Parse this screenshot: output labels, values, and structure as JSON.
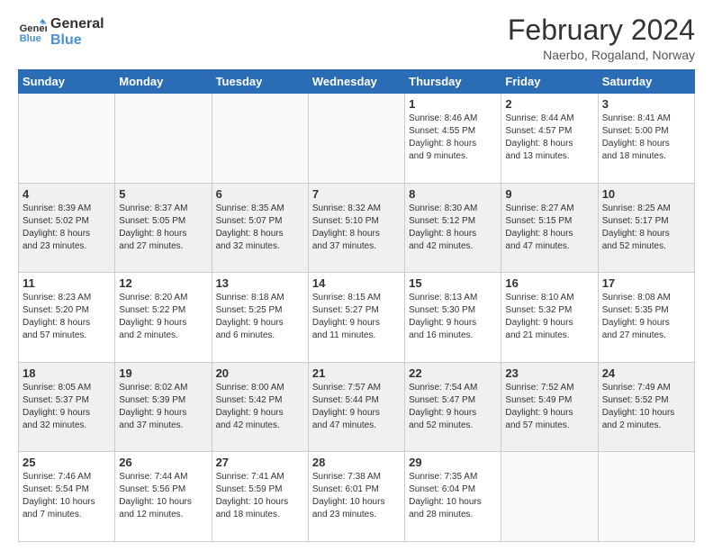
{
  "logo": {
    "text_general": "General",
    "text_blue": "Blue"
  },
  "title": "February 2024",
  "subtitle": "Naerbo, Rogaland, Norway",
  "days_of_week": [
    "Sunday",
    "Monday",
    "Tuesday",
    "Wednesday",
    "Thursday",
    "Friday",
    "Saturday"
  ],
  "weeks": [
    [
      {
        "day": "",
        "info": ""
      },
      {
        "day": "",
        "info": ""
      },
      {
        "day": "",
        "info": ""
      },
      {
        "day": "",
        "info": ""
      },
      {
        "day": "1",
        "info": "Sunrise: 8:46 AM\nSunset: 4:55 PM\nDaylight: 8 hours\nand 9 minutes."
      },
      {
        "day": "2",
        "info": "Sunrise: 8:44 AM\nSunset: 4:57 PM\nDaylight: 8 hours\nand 13 minutes."
      },
      {
        "day": "3",
        "info": "Sunrise: 8:41 AM\nSunset: 5:00 PM\nDaylight: 8 hours\nand 18 minutes."
      }
    ],
    [
      {
        "day": "4",
        "info": "Sunrise: 8:39 AM\nSunset: 5:02 PM\nDaylight: 8 hours\nand 23 minutes."
      },
      {
        "day": "5",
        "info": "Sunrise: 8:37 AM\nSunset: 5:05 PM\nDaylight: 8 hours\nand 27 minutes."
      },
      {
        "day": "6",
        "info": "Sunrise: 8:35 AM\nSunset: 5:07 PM\nDaylight: 8 hours\nand 32 minutes."
      },
      {
        "day": "7",
        "info": "Sunrise: 8:32 AM\nSunset: 5:10 PM\nDaylight: 8 hours\nand 37 minutes."
      },
      {
        "day": "8",
        "info": "Sunrise: 8:30 AM\nSunset: 5:12 PM\nDaylight: 8 hours\nand 42 minutes."
      },
      {
        "day": "9",
        "info": "Sunrise: 8:27 AM\nSunset: 5:15 PM\nDaylight: 8 hours\nand 47 minutes."
      },
      {
        "day": "10",
        "info": "Sunrise: 8:25 AM\nSunset: 5:17 PM\nDaylight: 8 hours\nand 52 minutes."
      }
    ],
    [
      {
        "day": "11",
        "info": "Sunrise: 8:23 AM\nSunset: 5:20 PM\nDaylight: 8 hours\nand 57 minutes."
      },
      {
        "day": "12",
        "info": "Sunrise: 8:20 AM\nSunset: 5:22 PM\nDaylight: 9 hours\nand 2 minutes."
      },
      {
        "day": "13",
        "info": "Sunrise: 8:18 AM\nSunset: 5:25 PM\nDaylight: 9 hours\nand 6 minutes."
      },
      {
        "day": "14",
        "info": "Sunrise: 8:15 AM\nSunset: 5:27 PM\nDaylight: 9 hours\nand 11 minutes."
      },
      {
        "day": "15",
        "info": "Sunrise: 8:13 AM\nSunset: 5:30 PM\nDaylight: 9 hours\nand 16 minutes."
      },
      {
        "day": "16",
        "info": "Sunrise: 8:10 AM\nSunset: 5:32 PM\nDaylight: 9 hours\nand 21 minutes."
      },
      {
        "day": "17",
        "info": "Sunrise: 8:08 AM\nSunset: 5:35 PM\nDaylight: 9 hours\nand 27 minutes."
      }
    ],
    [
      {
        "day": "18",
        "info": "Sunrise: 8:05 AM\nSunset: 5:37 PM\nDaylight: 9 hours\nand 32 minutes."
      },
      {
        "day": "19",
        "info": "Sunrise: 8:02 AM\nSunset: 5:39 PM\nDaylight: 9 hours\nand 37 minutes."
      },
      {
        "day": "20",
        "info": "Sunrise: 8:00 AM\nSunset: 5:42 PM\nDaylight: 9 hours\nand 42 minutes."
      },
      {
        "day": "21",
        "info": "Sunrise: 7:57 AM\nSunset: 5:44 PM\nDaylight: 9 hours\nand 47 minutes."
      },
      {
        "day": "22",
        "info": "Sunrise: 7:54 AM\nSunset: 5:47 PM\nDaylight: 9 hours\nand 52 minutes."
      },
      {
        "day": "23",
        "info": "Sunrise: 7:52 AM\nSunset: 5:49 PM\nDaylight: 9 hours\nand 57 minutes."
      },
      {
        "day": "24",
        "info": "Sunrise: 7:49 AM\nSunset: 5:52 PM\nDaylight: 10 hours\nand 2 minutes."
      }
    ],
    [
      {
        "day": "25",
        "info": "Sunrise: 7:46 AM\nSunset: 5:54 PM\nDaylight: 10 hours\nand 7 minutes."
      },
      {
        "day": "26",
        "info": "Sunrise: 7:44 AM\nSunset: 5:56 PM\nDaylight: 10 hours\nand 12 minutes."
      },
      {
        "day": "27",
        "info": "Sunrise: 7:41 AM\nSunset: 5:59 PM\nDaylight: 10 hours\nand 18 minutes."
      },
      {
        "day": "28",
        "info": "Sunrise: 7:38 AM\nSunset: 6:01 PM\nDaylight: 10 hours\nand 23 minutes."
      },
      {
        "day": "29",
        "info": "Sunrise: 7:35 AM\nSunset: 6:04 PM\nDaylight: 10 hours\nand 28 minutes."
      },
      {
        "day": "",
        "info": ""
      },
      {
        "day": "",
        "info": ""
      }
    ]
  ]
}
